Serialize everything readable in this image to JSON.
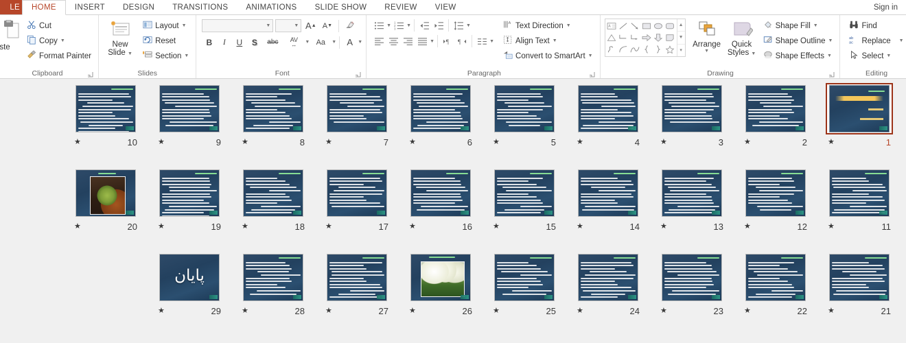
{
  "app": {
    "file_tab_label": "LE",
    "sign_in_label": "Sign in"
  },
  "tabs": [
    {
      "label": "HOME",
      "active": true
    },
    {
      "label": "INSERT",
      "active": false
    },
    {
      "label": "DESIGN",
      "active": false
    },
    {
      "label": "TRANSITIONS",
      "active": false
    },
    {
      "label": "ANIMATIONS",
      "active": false
    },
    {
      "label": "SLIDE SHOW",
      "active": false
    },
    {
      "label": "REVIEW",
      "active": false
    },
    {
      "label": "VIEW",
      "active": false
    }
  ],
  "ribbon": {
    "clipboard": {
      "group_label": "Clipboard",
      "paste_label": "ste",
      "cut_label": "Cut",
      "copy_label": "Copy",
      "format_painter_label": "Format Painter"
    },
    "slides": {
      "group_label": "Slides",
      "new_slide_line1": "New",
      "new_slide_line2": "Slide",
      "layout_label": "Layout",
      "reset_label": "Reset",
      "section_label": "Section"
    },
    "font": {
      "group_label": "Font",
      "font_name_value": "",
      "font_name_placeholder": "",
      "font_size_value": "",
      "font_size_placeholder": "",
      "grow_font": "A",
      "shrink_font": "A",
      "clear_formatting": "clear-formatting",
      "bold": "B",
      "italic": "I",
      "underline": "U",
      "shadow": "S",
      "strikethrough": "abc",
      "character_spacing": "AV",
      "change_case": "Aa",
      "font_color": "A"
    },
    "paragraph": {
      "group_label": "Paragraph",
      "text_direction_label": "Text Direction",
      "align_text_label": "Align Text",
      "convert_smartart_label": "Convert to SmartArt"
    },
    "drawing": {
      "group_label": "Drawing",
      "arrange_label": "Arrange",
      "quick_styles_line1": "Quick",
      "quick_styles_line2": "Styles",
      "shape_fill_label": "Shape Fill",
      "shape_outline_label": "Shape Outline",
      "shape_effects_label": "Shape Effects"
    },
    "editing": {
      "group_label": "Editing",
      "find_label": "Find",
      "replace_label": "Replace",
      "select_label": "Select"
    }
  },
  "sorter": {
    "star_glyph": "★",
    "selected_slide": 1,
    "rows": [
      [
        {
          "number": "1",
          "kind": "title",
          "selected": true,
          "lines": 0
        },
        {
          "number": "2",
          "kind": "text",
          "selected": false,
          "lines": 11
        },
        {
          "number": "3",
          "kind": "text",
          "selected": false,
          "lines": 10
        },
        {
          "number": "4",
          "kind": "text",
          "selected": false,
          "lines": 12
        },
        {
          "number": "5",
          "kind": "text",
          "selected": false,
          "lines": 11
        },
        {
          "number": "6",
          "kind": "text",
          "selected": false,
          "lines": 12
        },
        {
          "number": "7",
          "kind": "text",
          "selected": false,
          "lines": 10
        },
        {
          "number": "8",
          "kind": "text",
          "selected": false,
          "lines": 12
        },
        {
          "number": "9",
          "kind": "text",
          "selected": false,
          "lines": 11
        },
        {
          "number": "10",
          "kind": "text",
          "selected": false,
          "lines": 13
        }
      ],
      [
        {
          "number": "11",
          "kind": "text",
          "selected": false,
          "lines": 12
        },
        {
          "number": "12",
          "kind": "text",
          "selected": false,
          "lines": 11
        },
        {
          "number": "13",
          "kind": "text",
          "selected": false,
          "lines": 12
        },
        {
          "number": "14",
          "kind": "text",
          "selected": false,
          "lines": 11
        },
        {
          "number": "15",
          "kind": "text",
          "selected": false,
          "lines": 12
        },
        {
          "number": "16",
          "kind": "text",
          "selected": false,
          "lines": 11
        },
        {
          "number": "17",
          "kind": "text",
          "selected": false,
          "lines": 10
        },
        {
          "number": "18",
          "kind": "text",
          "selected": false,
          "lines": 12
        },
        {
          "number": "19",
          "kind": "text",
          "selected": false,
          "lines": 13
        },
        {
          "number": "20",
          "kind": "cactus",
          "selected": false,
          "lines": 0
        }
      ],
      [
        {
          "number": "21",
          "kind": "text",
          "selected": false,
          "lines": 11
        },
        {
          "number": "22",
          "kind": "text",
          "selected": false,
          "lines": 12
        },
        {
          "number": "23",
          "kind": "text",
          "selected": false,
          "lines": 11
        },
        {
          "number": "24",
          "kind": "text",
          "selected": false,
          "lines": 12
        },
        {
          "number": "25",
          "kind": "text",
          "selected": false,
          "lines": 11
        },
        {
          "number": "26",
          "kind": "flowers",
          "selected": false,
          "lines": 0
        },
        {
          "number": "27",
          "kind": "text",
          "selected": false,
          "lines": 12
        },
        {
          "number": "28",
          "kind": "text",
          "selected": false,
          "lines": 11
        },
        {
          "number": "29",
          "kind": "payan",
          "selected": false,
          "lines": 0,
          "text": "پایان"
        }
      ]
    ]
  },
  "colors": {
    "accent_red": "#b7472a",
    "selection_border": "#9c3318",
    "slide_bg_dark": "#23415f",
    "sorter_bg": "#f0f0f0",
    "ribbon_bg": "#ffffff"
  }
}
